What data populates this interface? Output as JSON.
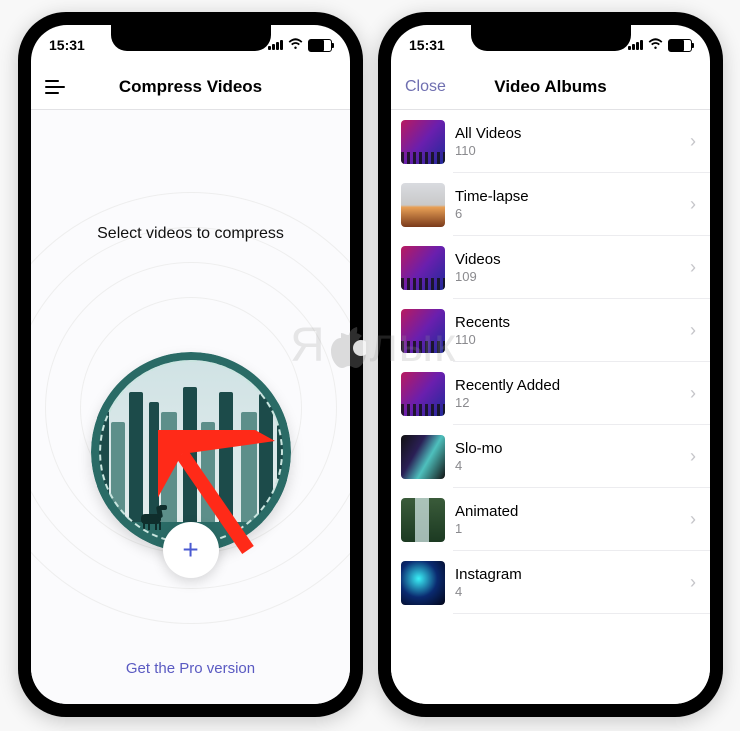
{
  "status": {
    "time": "15:31"
  },
  "left": {
    "title": "Compress Videos",
    "prompt": "Select videos to compress",
    "addGlyph": "+",
    "proLink": "Get the Pro version"
  },
  "right": {
    "title": "Video Albums",
    "close": "Close",
    "albums": [
      {
        "name": "All Videos",
        "count": "110",
        "thumb": "thumb-concert"
      },
      {
        "name": "Time-lapse",
        "count": "6",
        "thumb": "thumb-sunset"
      },
      {
        "name": "Videos",
        "count": "109",
        "thumb": "thumb-concert"
      },
      {
        "name": "Recents",
        "count": "110",
        "thumb": "thumb-concert"
      },
      {
        "name": "Recently Added",
        "count": "12",
        "thumb": "thumb-concert"
      },
      {
        "name": "Slo-mo",
        "count": "4",
        "thumb": "thumb-slomo"
      },
      {
        "name": "Animated",
        "count": "1",
        "thumb": "thumb-nature"
      },
      {
        "name": "Instagram",
        "count": "4",
        "thumb": "thumb-insta"
      }
    ]
  },
  "watermark": {
    "prefix": "Я",
    "suffix": "лык"
  },
  "arrow": {
    "color": "#ff2a18"
  },
  "medal": {
    "borderColor": "#2a6b66"
  }
}
